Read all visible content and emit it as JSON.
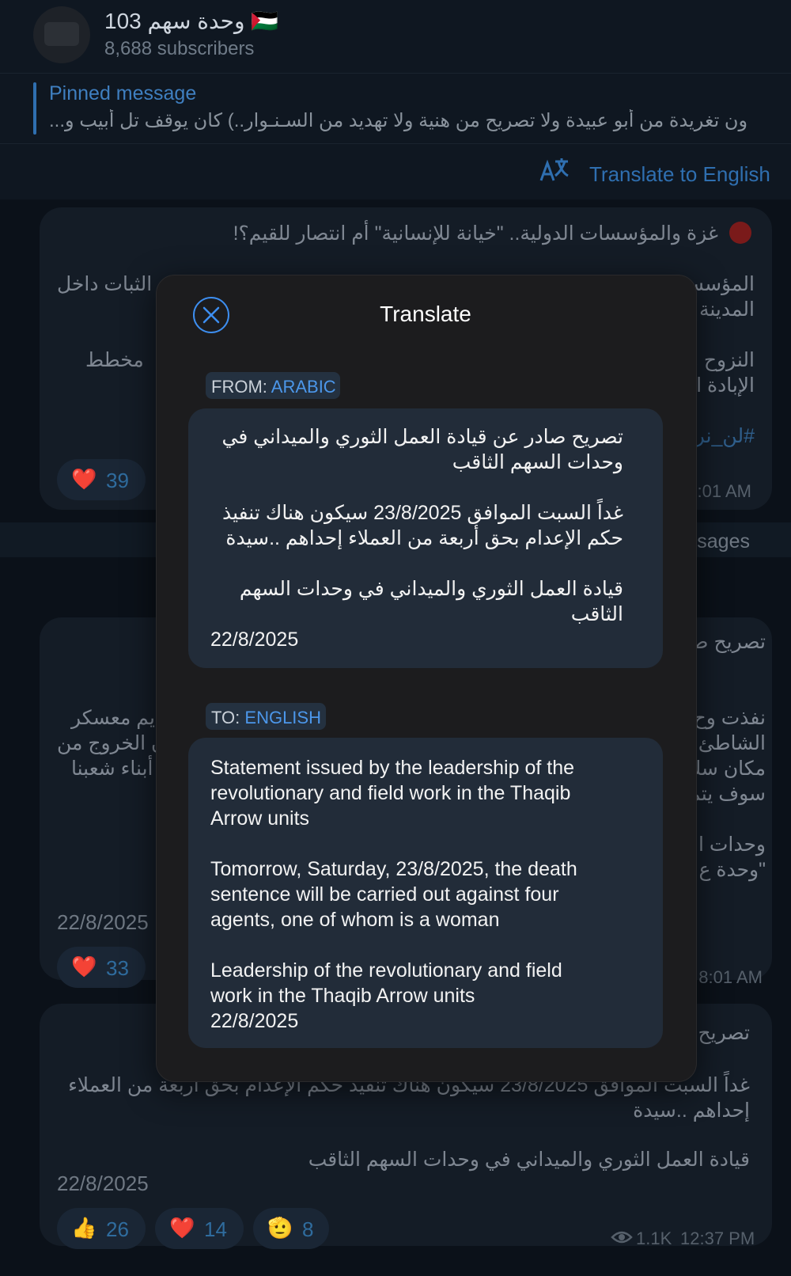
{
  "channel": {
    "title": "وحدة سهم 103 🇵🇸",
    "subscribers": "8,688 subscribers"
  },
  "pinned": {
    "label": "Pinned message",
    "text": "ون تغريدة من أبو عبيدة ولا تصريح من هنية ولا تهديد من السـنـوار..) كان يوقف تل أبيب و..."
  },
  "translate_bar": {
    "label": "Translate to English",
    "icon": "translate-icon"
  },
  "background_messages": {
    "msg1_title": "غزة والمؤسسات الدولية.. \"خيانة للإنسانية\" أم انتصار للقيم؟!",
    "msg1_line_a_right": "المؤسس",
    "msg1_line_a_left": "الثبات داخل",
    "msg1_line_b_right": "المدينة",
    "msg1_line_c_right": "النزوح و",
    "msg1_line_c_left": "مخطط",
    "msg1_line_d_right": "الإبادة ا",
    "msg1_hashtag": "#لن_نر",
    "msg1_reaction": {
      "emoji": "❤️",
      "count": "39"
    },
    "msg1_time": ":01 AM",
    "divider_text": "sages",
    "msg2_title_right": "تصريح ص",
    "msg2_line_a_right": "نفذت وح",
    "msg2_line_a_left": "يم معسكر",
    "msg2_line_b_right": "الشاطئ ا",
    "msg2_line_b_left": "ن الخروج من",
    "msg2_line_c_right": "مكان سك",
    "msg2_line_c_left": "أبناء شعبنا",
    "msg2_line_d_right": "سوف يتم",
    "msg2_line_e_right": "وحدات ا",
    "msg2_line_f_right": "\"وحدة ع",
    "msg2_date": "22/8/2025",
    "msg2_reaction": {
      "emoji": "❤️",
      "count": "33"
    },
    "msg2_time": "8:01 AM",
    "msg3_title_right": "تصريح",
    "msg3_line_a": "غداً السبت الموافق 23/8/2025 سيكون هناك تنفيذ حكم الإعدام بحق أربعة من العملاء",
    "msg3_line_b": "إحداهم ..سيدة",
    "msg3_line_c": "قيادة العمل الثوري والميداني في وحدات السهم الثاقب",
    "msg3_date": "22/8/2025",
    "msg3_reactions": [
      {
        "emoji": "👍",
        "count": "26"
      },
      {
        "emoji": "❤️",
        "count": "14"
      },
      {
        "emoji": "🫡",
        "count": "8"
      }
    ],
    "msg3_views": "1.1K",
    "msg3_time": "12:37 PM"
  },
  "modal": {
    "title": "Translate",
    "from_label": "FROM: ",
    "from_lang": "ARABIC",
    "to_label": "TO: ",
    "to_lang": "ENGLISH",
    "source_text": "تصريح صادر عن قيادة العمل الثوري والميداني في\nوحدات السهم الثاقب\n\nغداً السبت الموافق 23/8/2025 سيكون هناك تنفيذ\nحكم الإعدام بحق أربعة من العملاء إحداهم ..سيدة\n\nقيادة العمل الثوري والميداني في وحدات السهم\nالثاقب",
    "source_date": "22/8/2025",
    "translated_text": "Statement issued by the leadership of the\nrevolutionary and field work in the Thaqib\nArrow units\n\nTomorrow, Saturday, 23/8/2025, the death\nsentence will be carried out against four\nagents, one of whom is a woman\n\nLeadership of the revolutionary and field\nwork in the Thaqib Arrow units\n22/8/2025"
  },
  "colors": {
    "accent": "#3d8ef0",
    "background": "#0b1119",
    "modal": "#1c1c1e"
  }
}
